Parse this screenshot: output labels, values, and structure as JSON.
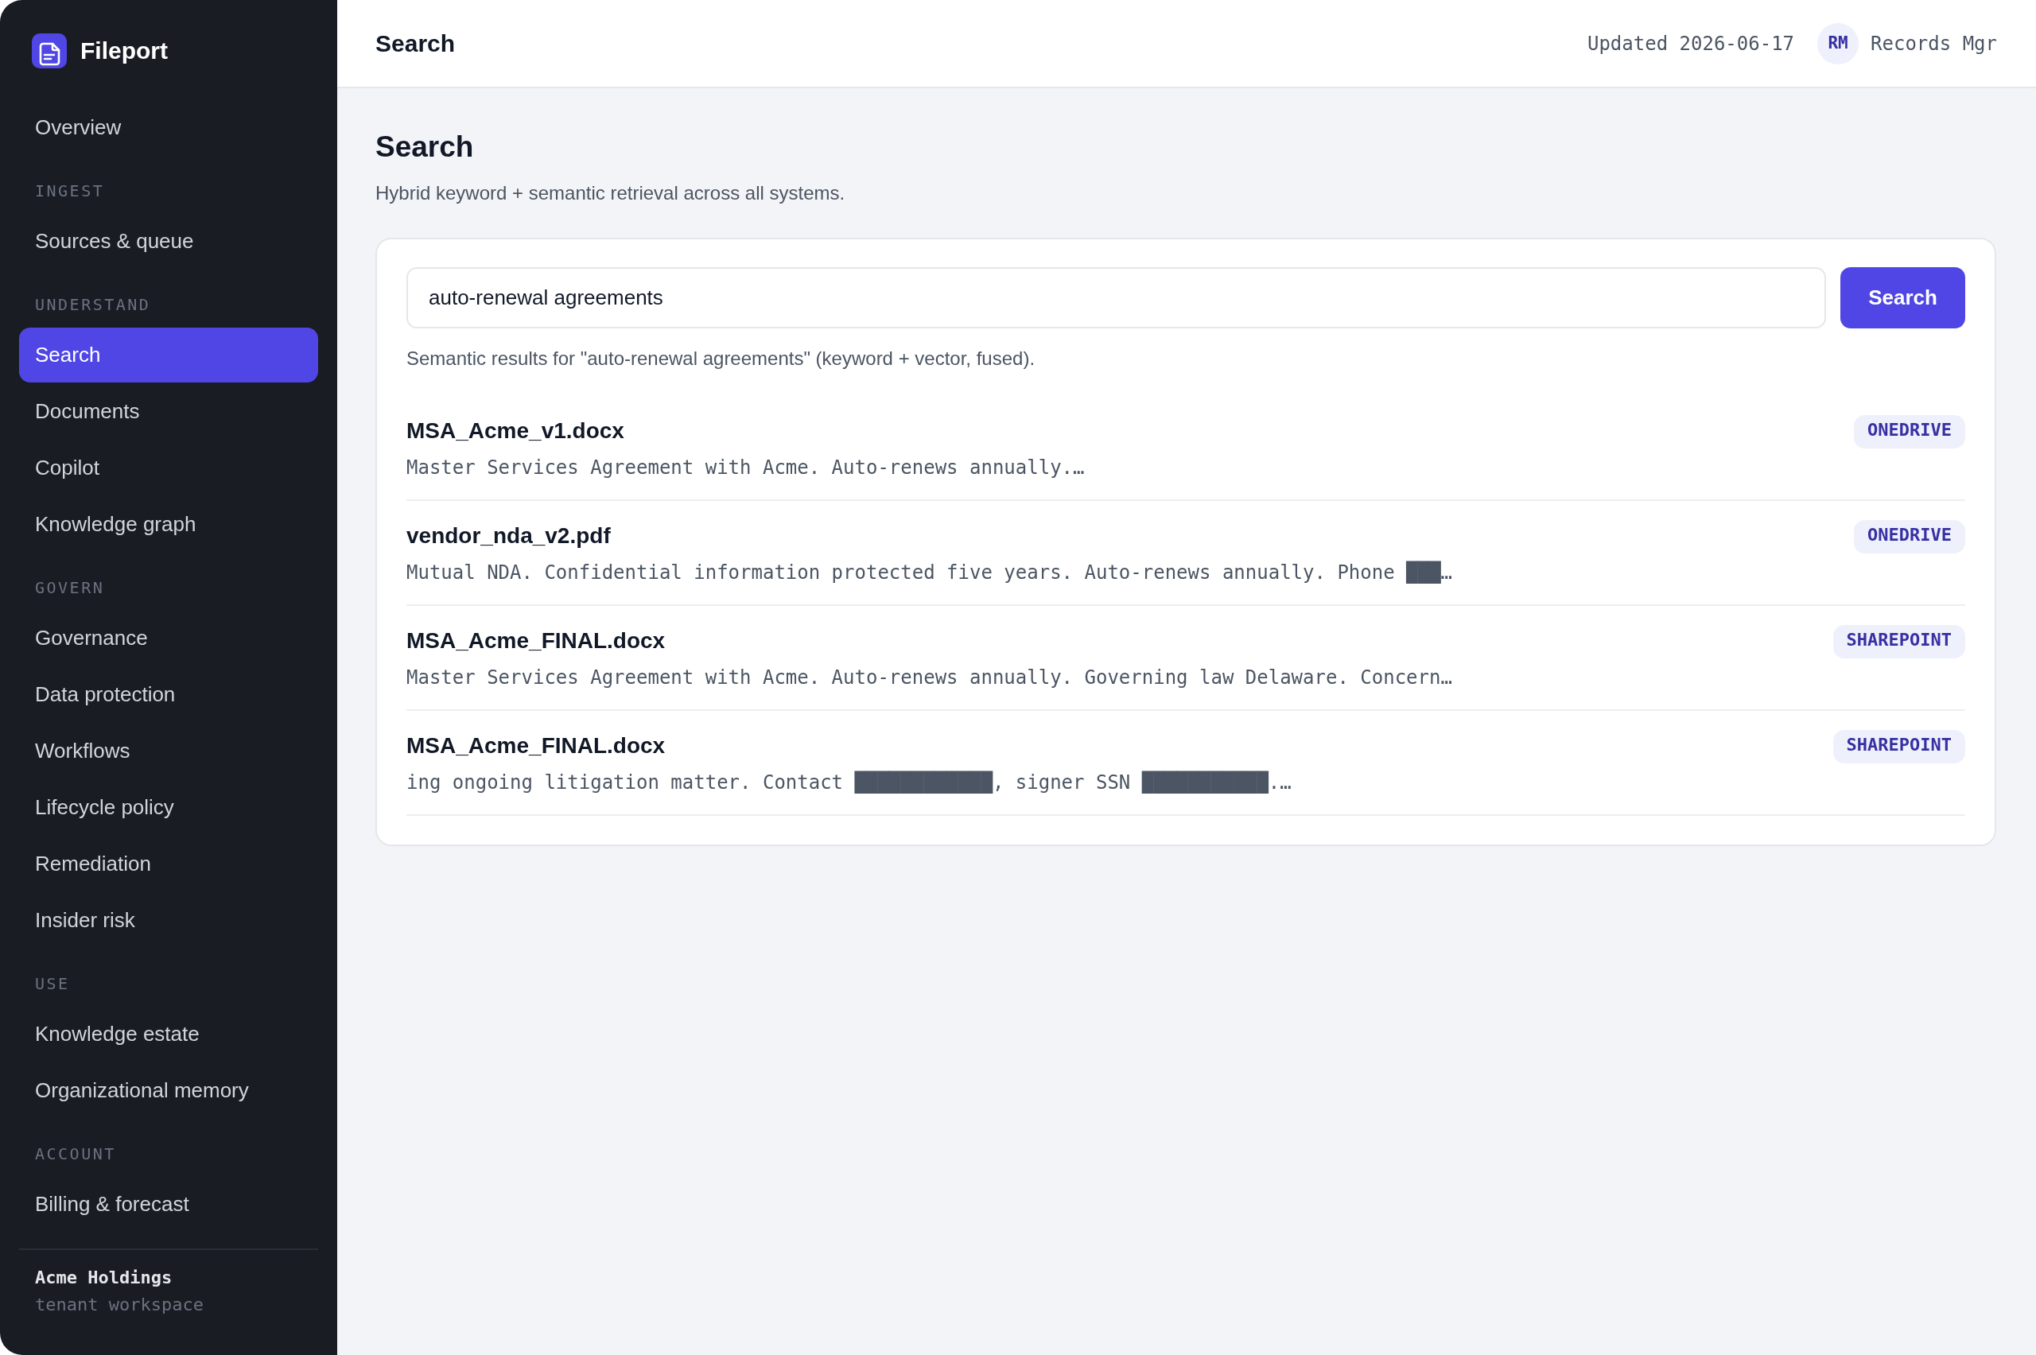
{
  "sidebar": {
    "app_name": "Fileport",
    "sections": [
      {
        "items": [
          {
            "label": "Overview",
            "selected": false
          }
        ]
      },
      {
        "heading": "INGEST",
        "items": [
          {
            "label": "Sources & queue",
            "selected": false
          }
        ]
      },
      {
        "heading": "UNDERSTAND",
        "items": [
          {
            "label": "Search",
            "selected": true
          },
          {
            "label": "Documents",
            "selected": false
          },
          {
            "label": "Copilot",
            "selected": false
          },
          {
            "label": "Knowledge graph",
            "selected": false
          }
        ]
      },
      {
        "heading": "GOVERN",
        "items": [
          {
            "label": "Governance",
            "selected": false
          },
          {
            "label": "Data protection",
            "selected": false
          },
          {
            "label": "Workflows",
            "selected": false
          },
          {
            "label": "Lifecycle policy",
            "selected": false
          },
          {
            "label": "Remediation",
            "selected": false
          },
          {
            "label": "Insider risk",
            "selected": false
          }
        ]
      },
      {
        "heading": "USE",
        "items": [
          {
            "label": "Knowledge estate",
            "selected": false
          },
          {
            "label": "Organizational memory",
            "selected": false
          }
        ]
      },
      {
        "heading": "ACCOUNT",
        "items": [
          {
            "label": "Billing & forecast",
            "selected": false
          }
        ]
      }
    ],
    "footer": {
      "org": "Acme Holdings",
      "caption": "tenant workspace"
    }
  },
  "header": {
    "title": "Search",
    "updated": "Updated 2026-06-17",
    "avatar": "RM",
    "user": "Records Mgr"
  },
  "page": {
    "title": "Search",
    "subtitle": "Hybrid keyword + semantic retrieval across all systems."
  },
  "search": {
    "value": "auto-renewal agreements",
    "button": "Search",
    "summary": "Semantic results for \"auto-renewal agreements\" (keyword + vector, fused)."
  },
  "results": [
    {
      "title": "MSA_Acme_v1.docx",
      "snippet": "Master Services Agreement with Acme. Auto-renews annually.…",
      "source": "ONEDRIVE"
    },
    {
      "title": "vendor_nda_v2.pdf",
      "snippet": "Mutual NDA. Confidential information protected five years. Auto-renews annually. Phone ███…",
      "source": "ONEDRIVE"
    },
    {
      "title": "MSA_Acme_FINAL.docx",
      "snippet": "Master Services Agreement with Acme. Auto-renews annually. Governing law Delaware. Concern…",
      "source": "SHAREPOINT"
    },
    {
      "title": "MSA_Acme_FINAL.docx",
      "snippet": "ing ongoing litigation matter. Contact ████████████, signer SSN ███████████.…",
      "source": "SHAREPOINT"
    }
  ]
}
